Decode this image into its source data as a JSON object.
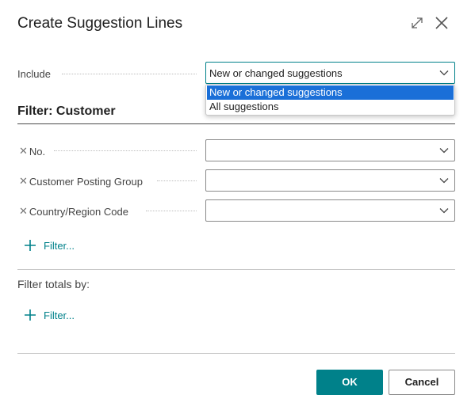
{
  "dialog": {
    "title": "Create Suggestion Lines"
  },
  "include": {
    "label": "Include",
    "value": "New or changed suggestions",
    "options": [
      "New or changed suggestions",
      "All suggestions"
    ]
  },
  "filter": {
    "heading": "Filter: Customer",
    "fields": [
      {
        "label": "No.",
        "value": ""
      },
      {
        "label": "Customer Posting Group",
        "value": ""
      },
      {
        "label": "Country/Region Code",
        "value": ""
      }
    ],
    "add_filter_label": "Filter..."
  },
  "totals": {
    "label": "Filter totals by:",
    "add_filter_label": "Filter..."
  },
  "buttons": {
    "ok": "OK",
    "cancel": "Cancel"
  },
  "colors": {
    "accent": "#00818a",
    "selection": "#1a6fd8"
  }
}
